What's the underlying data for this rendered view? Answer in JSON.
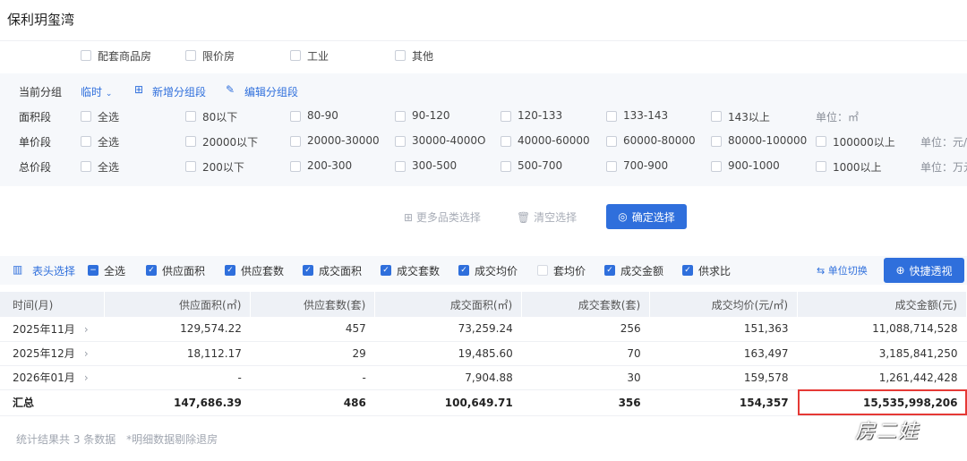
{
  "project_title": "保利玥玺湾",
  "property_types": [
    "配套商品房",
    "限价房",
    "工业",
    "其他"
  ],
  "group": {
    "label": "当前分组",
    "current": "临时",
    "add": "新增分组段",
    "edit": "编辑分组段"
  },
  "filters": {
    "area": {
      "label": "面积段",
      "options": [
        "全选",
        "80以下",
        "80-90",
        "90-120",
        "120-133",
        "133-143",
        "143以上"
      ],
      "unit": "单位：㎡"
    },
    "unit_price": {
      "label": "单价段",
      "options": [
        "全选",
        "20000以下",
        "20000-30000",
        "30000-4000O",
        "40000-60000",
        "60000-80000",
        "80000-100000",
        "100000以上"
      ],
      "unit": "单位：元/"
    },
    "total_price": {
      "label": "总价段",
      "options": [
        "全选",
        "200以下",
        "200-300",
        "300-500",
        "500-700",
        "700-900",
        "900-1000",
        "1000以上"
      ],
      "unit": "单位：万元"
    }
  },
  "actions": {
    "more": "更多品类选择",
    "clear": "清空选择",
    "confirm": "确定选择"
  },
  "columns_bar": {
    "label": "表头选择",
    "items": [
      {
        "label": "全选",
        "checked": true
      },
      {
        "label": "供应面积",
        "checked": true
      },
      {
        "label": "供应套数",
        "checked": true
      },
      {
        "label": "成交面积",
        "checked": true
      },
      {
        "label": "成交套数",
        "checked": true
      },
      {
        "label": "成交均价",
        "checked": true
      },
      {
        "label": "套均价",
        "checked": false
      },
      {
        "label": "成交金额",
        "checked": true
      },
      {
        "label": "供求比",
        "checked": true
      }
    ],
    "unit_switch": "单位切换",
    "quick_pivot": "快捷透视"
  },
  "table": {
    "headers": [
      "时间(月)",
      "供应面积(㎡)",
      "供应套数(套)",
      "成交面积(㎡)",
      "成交套数(套)",
      "成交均价(元/㎡)",
      "成交金额(元)"
    ],
    "rows": [
      [
        "2025年11月",
        "129,574.22",
        "457",
        "73,259.24",
        "256",
        "151,363",
        "11,088,714,528"
      ],
      [
        "2025年12月",
        "18,112.17",
        "29",
        "19,485.60",
        "70",
        "163,497",
        "3,185,841,250"
      ],
      [
        "2026年01月",
        "-",
        "-",
        "7,904.88",
        "30",
        "159,578",
        "1,261,442,428"
      ]
    ],
    "total": [
      "汇总",
      "147,686.39",
      "486",
      "100,649.71",
      "356",
      "154,357",
      "15,535,998,206"
    ]
  },
  "footer": {
    "stats": "统计结果共 3 条数据",
    "note": "*明细数据剔除退房"
  },
  "watermark": "房二娃",
  "colors": {
    "accent": "#2f6fdc",
    "highlight": "#e53935"
  }
}
